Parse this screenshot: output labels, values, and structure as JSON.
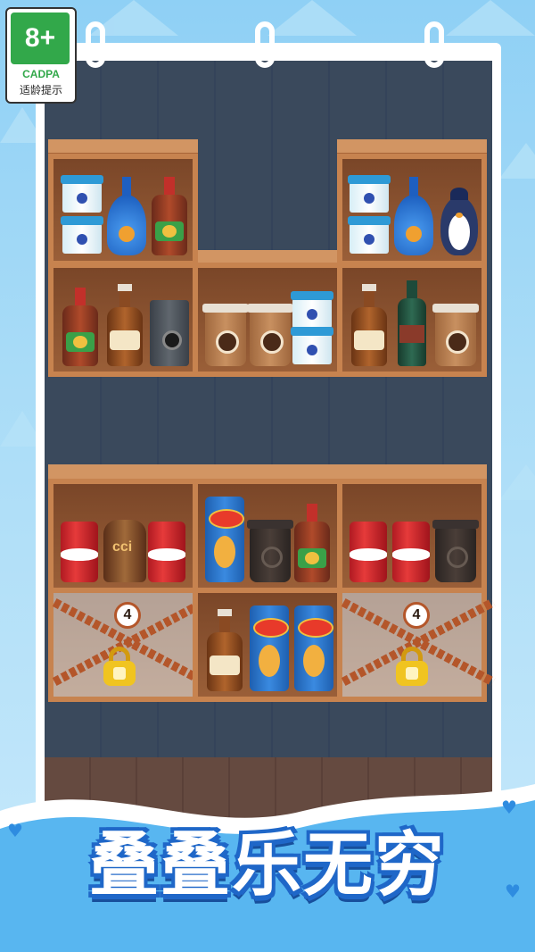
{
  "badge": {
    "age": "8+",
    "org": "CADPA",
    "tip": "适龄提示"
  },
  "lock_counts": {
    "left": "4",
    "right": "4"
  },
  "title": "叠叠乐无穷",
  "colors": {
    "sky": "#a9dcf7",
    "wall": "#3b4a5d",
    "shelf_wood": "#c7834f",
    "title_blue": "#1f67c8",
    "title_fill": "#ffffff"
  },
  "icons": [
    "lock-icon",
    "chain-icon",
    "heart-icon"
  ],
  "shelves": {
    "upper": {
      "left_top": [
        "yogurt-cups",
        "blue-bottle",
        "ketchup-bottle"
      ],
      "right_top": [
        "yogurt-cups",
        "blue-bottle",
        "penguin-toy"
      ],
      "left_bottom": [
        "ketchup-bottle",
        "beer-bottle",
        "juicer"
      ],
      "middle_bottom": [
        "coffee-cup",
        "coffee-cup",
        "yogurt-cups"
      ],
      "right_bottom": [
        "beer-bottle",
        "green-bottle",
        "coffee-cup"
      ]
    },
    "lower": {
      "left_top": [
        "cola-can",
        "juice-bottle",
        "cola-can"
      ],
      "middle_top": [
        "pringles-can",
        "black-coffee-cup",
        "ketchup-bottle"
      ],
      "right_top": [
        "cola-can",
        "cola-can",
        "black-coffee-cup"
      ],
      "left_bottom": [
        "locked"
      ],
      "middle_bottom": [
        "beer-bottle",
        "pringles-can",
        "pringles-can"
      ],
      "right_bottom": [
        "locked"
      ]
    }
  }
}
